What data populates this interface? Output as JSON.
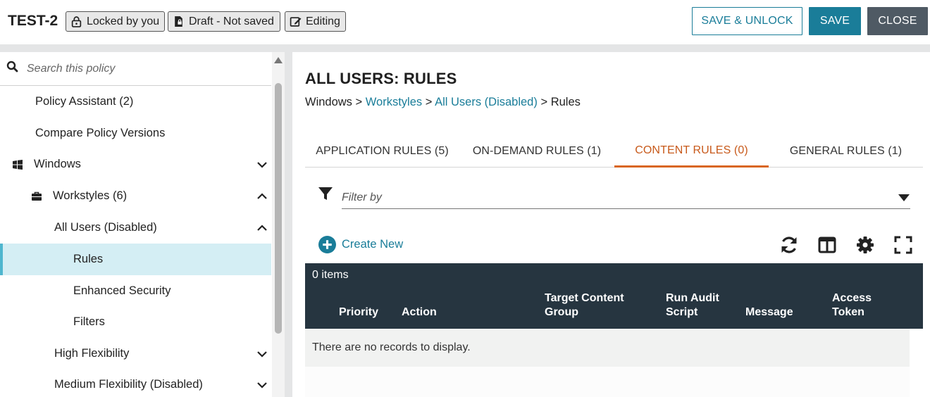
{
  "header": {
    "title": "TEST-2",
    "badges": {
      "locked": "Locked by you",
      "draft": "Draft - Not saved",
      "editing": "Editing"
    },
    "buttons": {
      "save_unlock": "SAVE & UNLOCK",
      "save": "SAVE",
      "close": "CLOSE"
    }
  },
  "sidebar": {
    "search_placeholder": "Search this policy",
    "items": [
      {
        "label": "Policy Assistant (2)"
      },
      {
        "label": "Compare Policy Versions"
      },
      {
        "label": "Windows",
        "icon": "windows-icon",
        "chevron": "down"
      },
      {
        "label": "Workstyles (6)",
        "icon": "briefcase-icon",
        "chevron": "up"
      },
      {
        "label": "All Users (Disabled)",
        "chevron": "up"
      },
      {
        "label": "Rules",
        "active": true
      },
      {
        "label": "Enhanced Security"
      },
      {
        "label": "Filters"
      },
      {
        "label": "High Flexibility",
        "chevron": "down"
      },
      {
        "label": "Medium Flexibility (Disabled)",
        "chevron": "down"
      }
    ]
  },
  "main": {
    "page_title": "ALL USERS: RULES",
    "breadcrumb": {
      "root": "Windows",
      "sep": ">",
      "link1": "Workstyles",
      "link2": "All Users (Disabled)",
      "current": "Rules"
    },
    "tabs": [
      {
        "label": "APPLICATION RULES (5)"
      },
      {
        "label": "ON-DEMAND RULES (1)"
      },
      {
        "label": "CONTENT RULES (0)",
        "active": true
      },
      {
        "label": "GENERAL RULES (1)"
      }
    ],
    "filter_placeholder": "Filter by",
    "create_new": "Create New",
    "grid": {
      "items_count": "0 items",
      "columns": [
        "Priority",
        "Action",
        "Target Content Group",
        "Run Audit Script",
        "Message",
        "Access Token"
      ],
      "columns_lines": [
        [
          "Priority"
        ],
        [
          "Action"
        ],
        [
          "Target Content",
          "Group"
        ],
        [
          "Run Audit",
          "Script"
        ],
        [
          "Message"
        ],
        [
          "Access",
          "Token"
        ]
      ],
      "empty_message": "There are no records to display."
    }
  },
  "colors": {
    "accent": "#1a7d99",
    "close_button": "#4f5a64",
    "active_tab": "#d9661f",
    "grid_header": "#263540",
    "active_item_bg": "#d4eef4"
  }
}
